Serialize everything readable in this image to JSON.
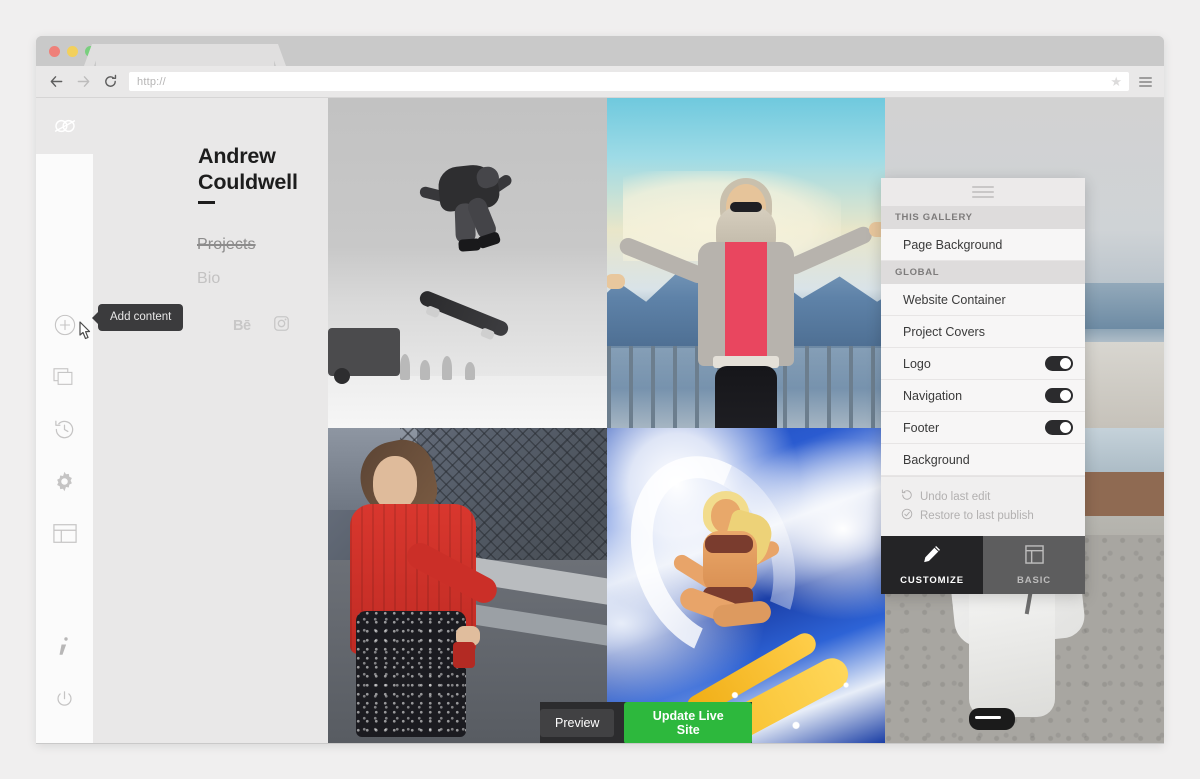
{
  "browser": {
    "url_placeholder": "http://",
    "back_icon": "back-arrow-icon",
    "forward_icon": "forward-arrow-icon",
    "reload_icon": "reload-icon",
    "bookmark_icon": "star-icon",
    "menu_icon": "hamburger-menu-icon"
  },
  "rail": {
    "logo": "creative-cloud-icon",
    "items": [
      {
        "icon": "add-content-plus-icon",
        "name": "add-content"
      },
      {
        "icon": "layers-icon",
        "name": "pages"
      },
      {
        "icon": "history-clock-icon",
        "name": "history"
      },
      {
        "icon": "gear-icon",
        "name": "settings"
      },
      {
        "icon": "layout-grid-icon",
        "name": "layout"
      }
    ],
    "bottom_items": [
      {
        "icon": "info-icon",
        "name": "info"
      },
      {
        "icon": "power-icon",
        "name": "power"
      }
    ]
  },
  "tooltip": {
    "text": "Add content"
  },
  "site": {
    "title_line1": "Andrew",
    "title_line2": "Couldwell",
    "nav": [
      {
        "label": "Projects",
        "state": "active"
      },
      {
        "label": "Bio",
        "state": "default"
      }
    ],
    "social": [
      {
        "label": "Bē",
        "icon": "behance-icon"
      },
      {
        "label": "",
        "icon": "instagram-icon"
      }
    ]
  },
  "actionbar": {
    "preview_label": "Preview",
    "update_label": "Update Live Site",
    "update_color": "#2db83d"
  },
  "panel": {
    "drag_handle": "drag-handle-icon",
    "sections": [
      {
        "label": "THIS GALLERY",
        "rows": [
          {
            "label": "Page Background",
            "toggle": false
          }
        ]
      },
      {
        "label": "GLOBAL",
        "rows": [
          {
            "label": "Website Container",
            "toggle": false
          },
          {
            "label": "Project Covers",
            "toggle": false
          },
          {
            "label": "Logo",
            "toggle": true,
            "on": true
          },
          {
            "label": "Navigation",
            "toggle": true,
            "on": true
          },
          {
            "label": "Footer",
            "toggle": true,
            "on": true
          },
          {
            "label": "Background",
            "toggle": false
          }
        ]
      }
    ],
    "actions": [
      {
        "label": "Undo last edit",
        "icon": "undo-icon"
      },
      {
        "label": "Restore to last publish",
        "icon": "restore-check-icon"
      }
    ],
    "tabs": [
      {
        "label": "CUSTOMIZE",
        "icon": "pencil-icon",
        "active": true
      },
      {
        "label": "BASIC",
        "icon": "layout-panel-icon",
        "active": false
      }
    ]
  }
}
